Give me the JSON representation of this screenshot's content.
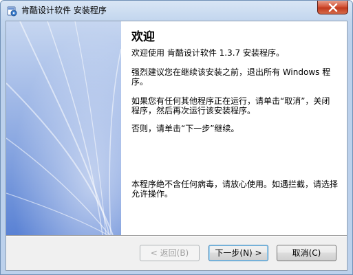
{
  "window": {
    "title": "肯酷设计软件 安装程序",
    "app_icon": "installer-icon",
    "close_icon": "close-icon",
    "colors": {
      "close_button": "#c13a1e",
      "side_panel_top": "#c3d3ee",
      "side_panel_bottom": "#5e86d6"
    }
  },
  "content": {
    "heading": "欢迎",
    "intro": "欢迎使用 肯酷设计软件 1.3.7 安装程序。",
    "advice": "强烈建议您在继续该安装之前，退出所有 Windows 程序。",
    "close_programs": "如果您有任何其他程序正在运行，请单击“取消”，关闭程序，然后再次运行该安装程序。",
    "otherwise": "否则，请单击“下一步”继续。",
    "virus_note": "本程序绝不含任何病毒，请放心使用。如遇拦截，请选择允许操作。"
  },
  "buttons": {
    "back_label": "< 返回(B)",
    "next_label": "下一步(N) >",
    "cancel_label": "取消(C)"
  }
}
